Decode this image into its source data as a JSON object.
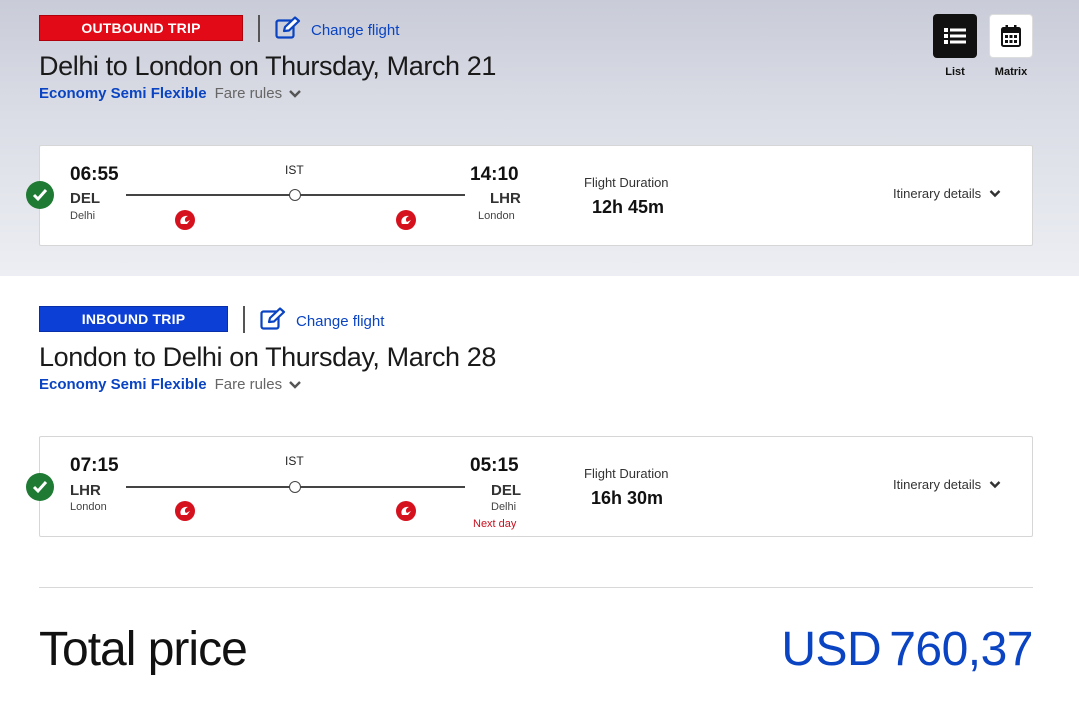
{
  "outbound": {
    "badge": "OUTBOUND TRIP",
    "change_label": "Change flight",
    "title": "Delhi to London on Thursday, March 21",
    "fare_class": "Economy Semi Flexible",
    "fare_rules": "Fare rules",
    "card": {
      "dep_time": "06:55",
      "dep_code": "DEL",
      "dep_city": "Delhi",
      "arr_time": "14:10",
      "arr_code": "LHR",
      "arr_city": "London",
      "hub": "IST",
      "duration_label": "Flight Duration",
      "duration": "12h 45m",
      "itinerary_label": "Itinerary details"
    }
  },
  "view_toggle": {
    "list_label": "List",
    "matrix_label": "Matrix"
  },
  "inbound": {
    "badge": "INBOUND TRIP",
    "change_label": "Change flight",
    "title": "London to Delhi on Thursday, March 28",
    "fare_class": "Economy Semi Flexible",
    "fare_rules": "Fare rules",
    "card": {
      "dep_time": "07:15",
      "dep_code": "LHR",
      "dep_city": "London",
      "arr_time": "05:15",
      "arr_code": "DEL",
      "arr_city": "Delhi",
      "next_day": "Next day",
      "hub": "IST",
      "duration_label": "Flight Duration",
      "duration": "16h 30m",
      "itinerary_label": "Itinerary details"
    }
  },
  "total": {
    "label": "Total price",
    "currency": "USD",
    "amount": "760,37"
  },
  "colors": {
    "outbound_badge": "#e30a17",
    "inbound_badge": "#0b3fd6",
    "link_blue": "#0a44c2",
    "check_green": "#1f7a34",
    "airline_red": "#d6111e"
  }
}
